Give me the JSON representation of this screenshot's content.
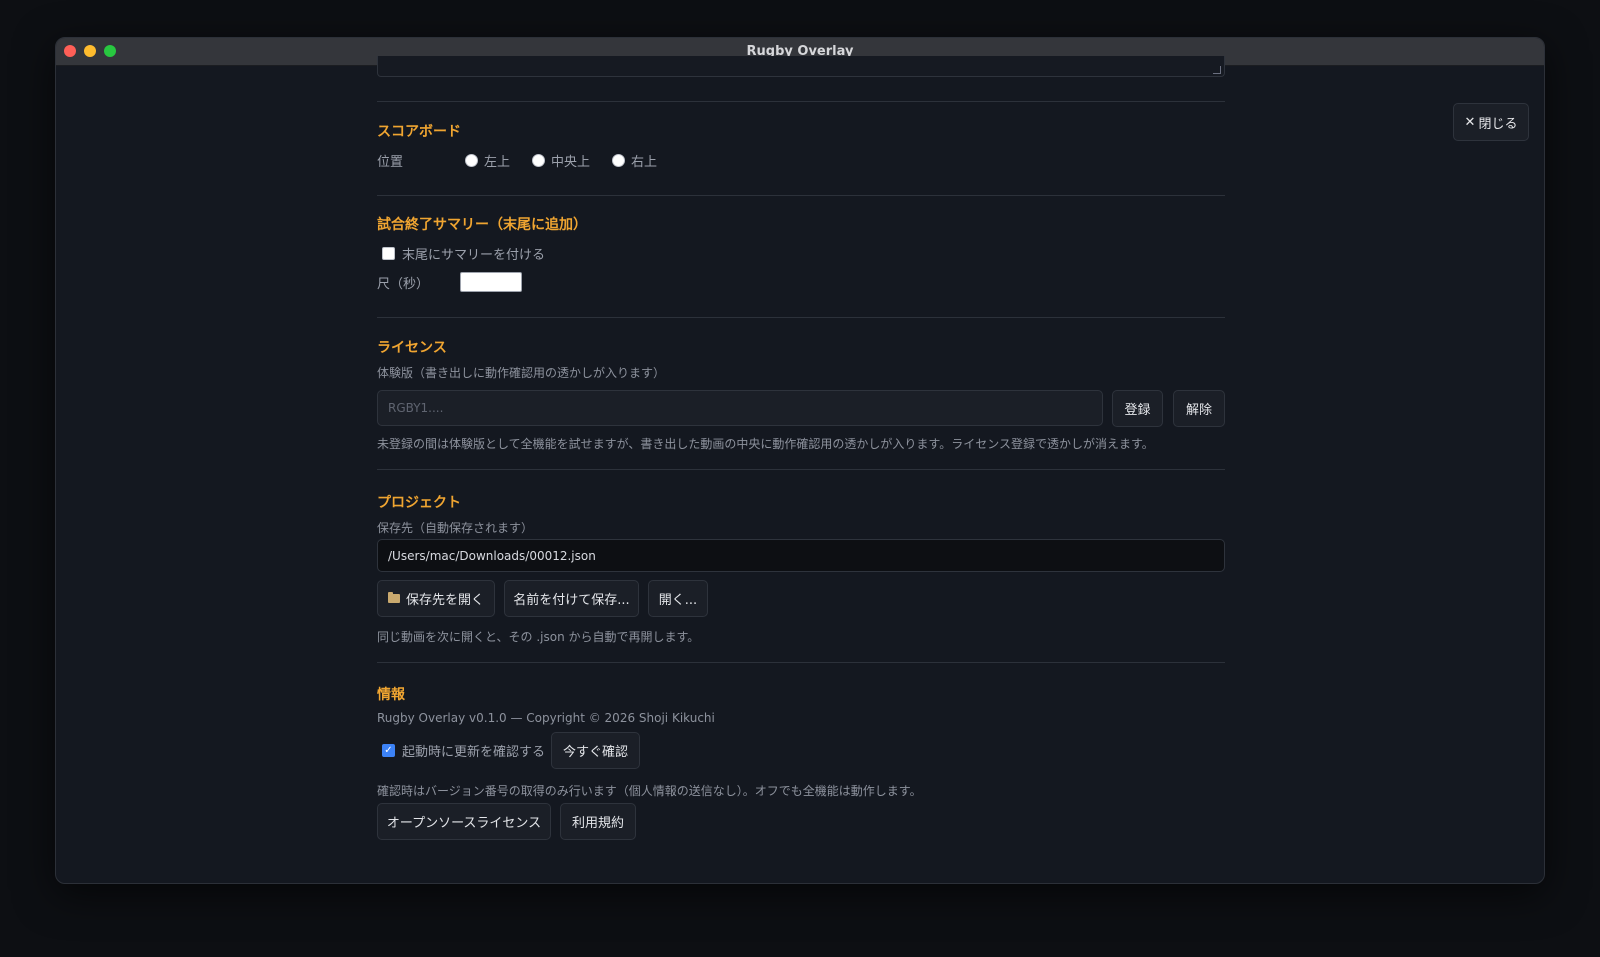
{
  "window": {
    "title": "Rugby Overlay"
  },
  "header": {
    "close_label": "閉じる"
  },
  "scoreboard": {
    "title": "スコアボード",
    "position_label": "位置",
    "options": [
      "左上",
      "中央上",
      "右上"
    ]
  },
  "summary": {
    "title": "試合終了サマリー（末尾に追加）",
    "checkbox_label": "末尾にサマリーを付ける",
    "duration_label": "尺（秒）"
  },
  "license": {
    "title": "ライセンス",
    "status": "体験版（書き出しに動作確認用の透かしが入ります）",
    "key_placeholder": "RGBY1....",
    "register_label": "登録",
    "revoke_label": "解除",
    "note": "未登録の間は体験版として全機能を試せますが、書き出した動画の中央に動作確認用の透かしが入ります。ライセンス登録で透かしが消えます。"
  },
  "project": {
    "title": "プロジェクト",
    "path_label": "保存先（自動保存されます）",
    "path_value": "/Users/mac/Downloads/00012.json",
    "open_location_label": "保存先を開く",
    "save_as_label": "名前を付けて保存...",
    "open_label": "開く...",
    "note": "同じ動画を次に開くと、その .json から自動で再開します。"
  },
  "info": {
    "title": "情報",
    "version": "Rugby Overlay v0.1.0 — Copyright © 2026 Shoji Kikuchi",
    "update_check_label": "起動時に更新を確認する",
    "check_now_label": "今すぐ確認",
    "note": "確認時はバージョン番号の取得のみ行います（個人情報の送信なし）。オフでも全機能は動作します。",
    "oss_label": "オープンソースライセンス",
    "terms_label": "利用規約"
  }
}
